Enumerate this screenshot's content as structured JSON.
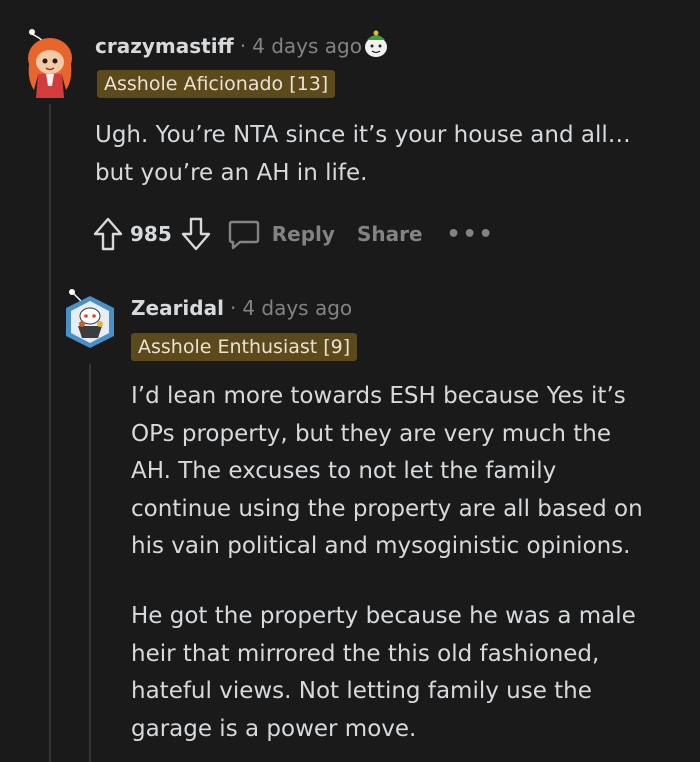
{
  "comment1": {
    "username": "crazymastiff",
    "separator": "·",
    "time": "4 days ago",
    "flair": "Asshole Aficionado [13]",
    "lines": [
      "Ugh. You’re NTA since it’s your house and all…",
      "but you’re an AH in life."
    ],
    "score": "985",
    "reply_label": "Reply",
    "share_label": "Share",
    "more_label": "•••"
  },
  "comment2": {
    "username": "Zearidal",
    "separator": "·",
    "time": "4 days ago",
    "flair": "Asshole Enthusiast [9]",
    "paragraph1": [
      "I’d lean more towards ESH because Yes it’s",
      "OPs property, but they are very much the",
      "AH. The excuses to not let the family",
      "continue using the property are all based on",
      "his vain political and mysoginistic opinions."
    ],
    "paragraph2": [
      "He got the property because he was a male",
      "heir that mirrored the this old fashioned,",
      "hateful views. Not letting family use the",
      "garage is a power move."
    ]
  }
}
